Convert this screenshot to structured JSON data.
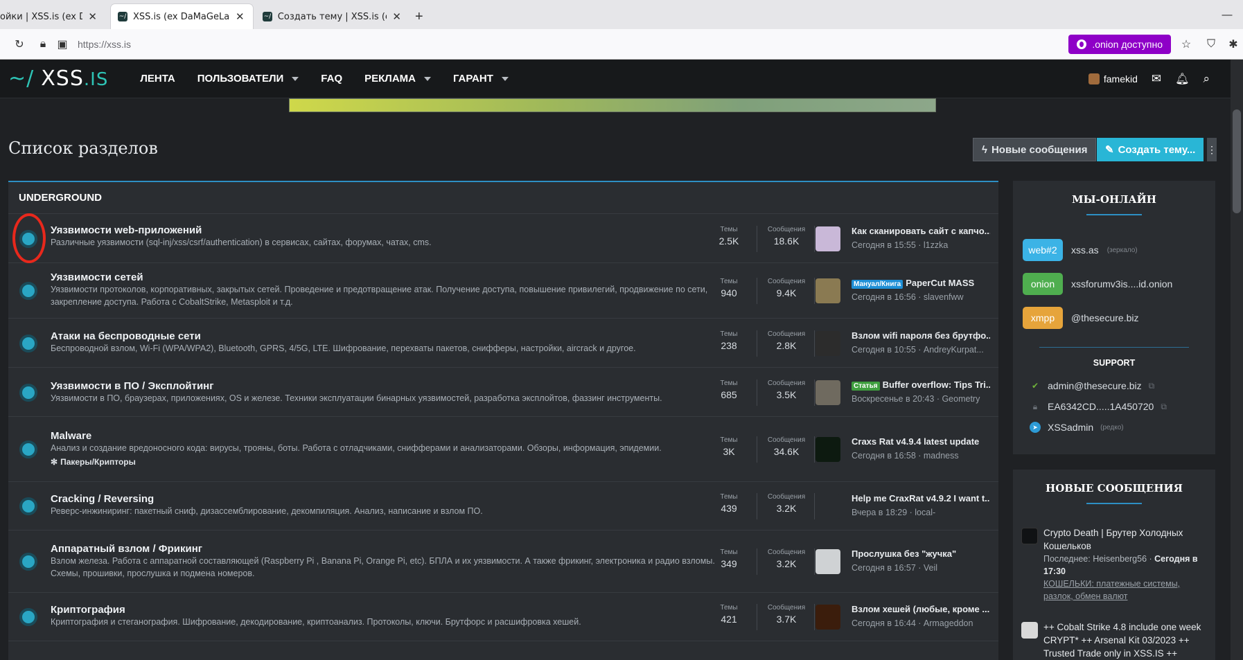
{
  "browser": {
    "tabs": [
      {
        "title": "ойки | XSS.is (ex DaMaGeL",
        "active": false
      },
      {
        "title": "XSS.is (ex DaMaGeLaB)",
        "active": true
      },
      {
        "title": "Создать тему | XSS.is (ex DaMaG",
        "active": false
      }
    ],
    "new_tab": "+",
    "url": "https://xss.is",
    "onion_label": ".onion доступно"
  },
  "header": {
    "logo_prefix": "~/",
    "logo_main": "XSS",
    "logo_suffix": ".IS",
    "nav": [
      {
        "label": "ЛЕНТА",
        "dropdown": false
      },
      {
        "label": "ПОЛЬЗОВАТЕЛИ",
        "dropdown": true
      },
      {
        "label": "FAQ",
        "dropdown": false
      },
      {
        "label": "РЕКЛАМА",
        "dropdown": true
      },
      {
        "label": "ГАРАНТ",
        "dropdown": true
      }
    ],
    "username": "famekid"
  },
  "page": {
    "title": "Список разделов",
    "new_posts_button": "Новые сообщения",
    "create_thread_button": "Создать тему..."
  },
  "forum": {
    "category": "UNDERGROUND",
    "threads_label": "Темы",
    "posts_label": "Сообщения",
    "nodes": [
      {
        "title": "Уязвимости web-приложений",
        "desc": "Различные уязвимости (sql-inj/xss/csrf/authentication) в сервисах, сайтах, форумах, чатах, cms.",
        "threads": "2.5K",
        "posts": "18.6K",
        "last_prefix": "",
        "last_title": "Как сканировать сайт с капчо...",
        "last_meta": "Сегодня в 15:55 · l1zzka"
      },
      {
        "title": "Уязвимости сетей",
        "desc": "Уязвимости протоколов, корпоративных, закрытых сетей. Проведение и предотвращение атак. Получение доступа, повышение привилегий, продвижение по сети, закрепление доступа. Работа с CobaltStrike, Metasploit и т.д.",
        "threads": "940",
        "posts": "9.4K",
        "last_prefix": "Мануал/Книга",
        "last_title": "PaperCut MASS",
        "last_meta": "Сегодня в 16:56 · slavenfww"
      },
      {
        "title": "Атаки на беспроводные сети",
        "desc": "Беспроводной взлом, Wi-Fi (WPA/WPA2), Bluetooth, GPRS, 4/5G, LTE. Шифрование, перехваты пакетов, снифферы, настройки, aircrack и другое.",
        "threads": "238",
        "posts": "2.8K",
        "last_prefix": "",
        "last_title": "Взлом wifi пароля без брутфо...",
        "last_meta": "Сегодня в 10:55 · AndreyKurpat..."
      },
      {
        "title": "Уязвимости в ПО / Эксплойтинг",
        "desc": "Уязвимости в ПО, браузерах, приложениях, OS и железе. Техники эксплуатации бинарных уязвимостей, разработка эксплойтов, фаззинг инструменты.",
        "threads": "685",
        "posts": "3.5K",
        "last_prefix": "Статья",
        "last_title": "Buffer overflow: Tips Tri...",
        "last_meta": "Воскресенье в 20:43 · Geometry"
      },
      {
        "title": "Malware",
        "desc": "Анализ и создание вредоносного кода: вирусы, трояны, боты. Работа с отладчиками, снифферами и анализаторами. Обзоры, информация, эпидемии.",
        "sub": "Пакеры/Крипторы",
        "threads": "3K",
        "posts": "34.6K",
        "last_prefix": "",
        "last_title": "Craxs Rat v4.9.4 latest update",
        "last_meta": "Сегодня в 16:58 · madness"
      },
      {
        "title": "Cracking / Reversing",
        "desc": "Реверс-инжиниринг: пакетный сниф, дизассемблирование, декомпиляция. Анализ, написание и взлом ПО.",
        "threads": "439",
        "posts": "3.2K",
        "last_prefix": "",
        "last_title": "Help me CraxRat v4.9.2 I want t...",
        "last_meta": "Вчера в 18:29 · local-"
      },
      {
        "title": "Аппаратный взлом / Фрикинг",
        "desc": "Взлом железа. Работа с аппаратной составляющей (Raspberry Pi , Banana Pi, Orange Pi, etc). БПЛА и их уязвимости. А также фрикинг, электроника и радио взломы. Схемы, прошивки, прослушка и подмена номеров.",
        "threads": "349",
        "posts": "3.2K",
        "last_prefix": "",
        "last_title": "Прослушка без \"жучка\"",
        "last_meta": "Сегодня в 16:57 · Veil"
      },
      {
        "title": "Криптография",
        "desc": "Криптография и стеганография. Шифрование, декодирование, криптоанализ. Протоколы, ключи. Брутфорс и расшифровка хешей.",
        "threads": "421",
        "posts": "3.7K",
        "last_prefix": "",
        "last_title": "Взлом хешей (любые, кроме ...",
        "last_meta": "Сегодня в 16:44 · Armageddon"
      }
    ]
  },
  "sidebar": {
    "online_title": "МЫ-ОНЛАЙН",
    "mirrors": [
      {
        "badge": "web#2",
        "label": "xss.as",
        "note": "(зеркало)",
        "color": "#3bb3e6"
      },
      {
        "badge": "onion",
        "label": "xssforumv3is....id.onion",
        "note": "",
        "color": "#4fae4f"
      },
      {
        "badge": "xmpp",
        "label": "@thesecure.biz",
        "note": "",
        "color": "#e6a43b"
      }
    ],
    "support_title": "SUPPORT",
    "support": [
      {
        "label": "admin@thesecure.biz",
        "note": ""
      },
      {
        "label": "EA6342CD.....1A450720",
        "note": ""
      },
      {
        "label": "XSSadmin",
        "note": "(редко)"
      }
    ],
    "new_posts_title": "НОВЫЕ СООБЩЕНИЯ",
    "posts": [
      {
        "title": "Crypto Death | Брутер Холодных Кошельков",
        "last": "Последнее: Heisenberg56 · ",
        "when": "Сегодня в 17:30",
        "forum": "КОШЕЛЬКИ: платежные системы, разлок, обмен валют"
      },
      {
        "title": "++ Cobalt Strike 4.8 include one week CRYPT* ++ Arsenal Kit 03/2023 ++ Trusted Trade only in XSS.IS ++",
        "last": "",
        "when": "",
        "forum": ""
      }
    ]
  }
}
